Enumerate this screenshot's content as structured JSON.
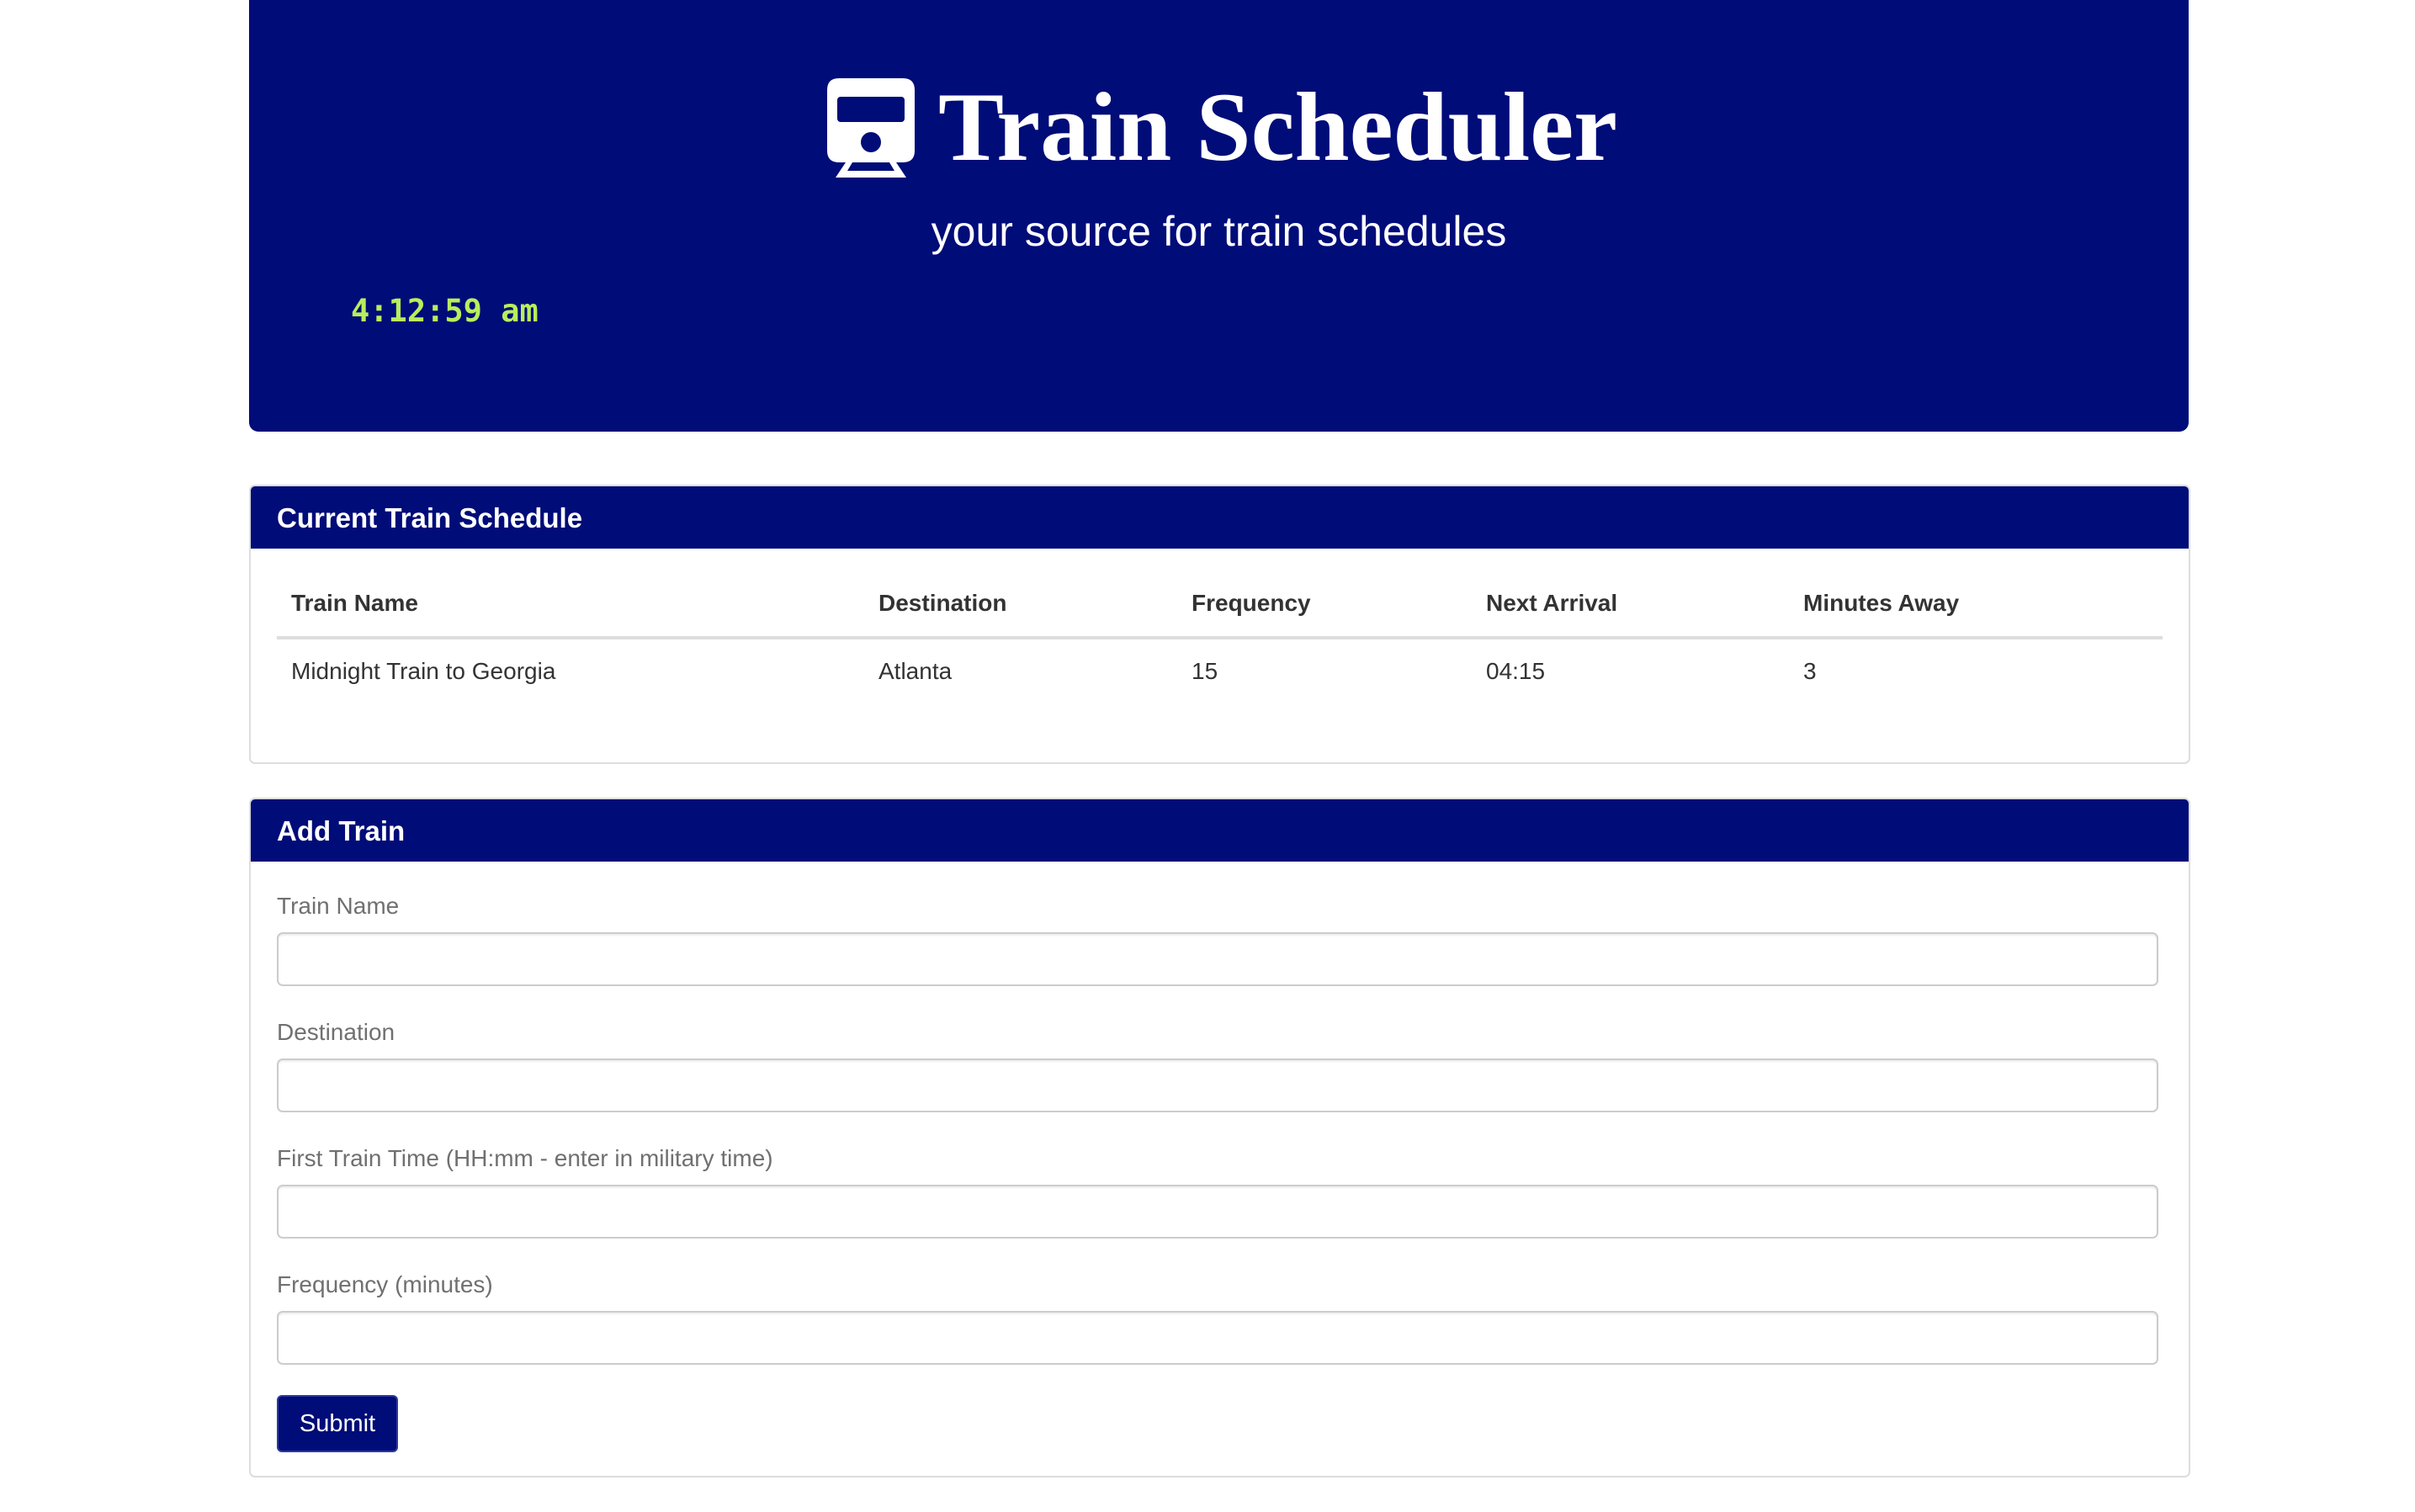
{
  "header": {
    "title": "Train Scheduler",
    "subtitle": "your source for train schedules",
    "clock": "4:12:59 am",
    "icon": "train-icon",
    "background_color": "#000c78",
    "clock_color": "#b7ee5c"
  },
  "schedule": {
    "heading": "Current Train Schedule",
    "columns": [
      "Train Name",
      "Destination",
      "Frequency",
      "Next Arrival",
      "Minutes Away"
    ],
    "rows": [
      [
        "Midnight Train to Georgia",
        "Atlanta",
        "15",
        "04:15",
        "3"
      ]
    ]
  },
  "add_train": {
    "heading": "Add Train",
    "fields": [
      {
        "label": "Train Name",
        "value": "",
        "placeholder": ""
      },
      {
        "label": "Destination",
        "value": "",
        "placeholder": ""
      },
      {
        "label": "First Train Time (HH:mm - enter in military time)",
        "value": "",
        "placeholder": ""
      },
      {
        "label": "Frequency (minutes)",
        "value": "",
        "placeholder": ""
      }
    ],
    "submit_label": "Submit"
  }
}
